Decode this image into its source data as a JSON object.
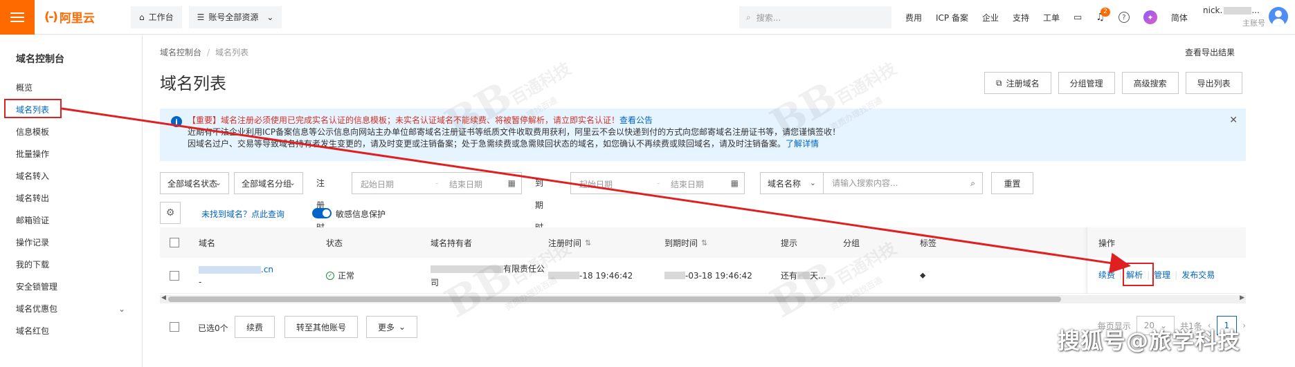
{
  "topbar": {
    "logo_mark": "(-)",
    "logo_text": "阿里云",
    "workbench": "工作台",
    "account_resources": "账号全部资源",
    "search_placeholder": "搜索...",
    "links": [
      "费用",
      "ICP 备案",
      "企业",
      "支持",
      "工单"
    ],
    "bell_badge": "2",
    "lang": "简体",
    "user_name": "nick.",
    "user_role": "主账号"
  },
  "sidebar": {
    "title": "域名控制台",
    "items": [
      {
        "label": "概览"
      },
      {
        "label": "域名列表",
        "active": true
      },
      {
        "label": "信息模板"
      },
      {
        "label": "批量操作"
      },
      {
        "label": "域名转入"
      },
      {
        "label": "域名转出"
      },
      {
        "label": "邮箱验证"
      },
      {
        "label": "操作记录"
      },
      {
        "label": "我的下载"
      },
      {
        "label": "安全锁管理"
      },
      {
        "label": "域名优惠包",
        "expandable": true
      },
      {
        "label": "域名红包"
      }
    ]
  },
  "main": {
    "breadcrumb": [
      "域名控制台",
      "域名列表"
    ],
    "export_result": "查看导出结果",
    "title": "域名列表",
    "header_buttons": {
      "register": "注册域名",
      "group": "分组管理",
      "advanced": "高级搜索",
      "export": "导出列表"
    },
    "notice": {
      "line1_red": "【重要】域名注册必须使用已完成实名认证的信息模板；未实名认证域名不能续费、将被暂停解析，请立即实名认证！",
      "line1_link": "查看公告",
      "line2": "近期有不法企业利用ICP备案信息等公示信息向网站主办单位邮寄域名注册证书等纸质文件收取费用获利，阿里云不会以快递到付的方式向您邮寄域名注册证书等，请您谨慎签收！",
      "line3": "因域名过户、交易等导致域名持有者发生变更的，请及时变更或注销备案；处于急需续费或急需赎回状态的域名，如您确认不再续费或赎回域名，请及时注销备案。",
      "line3_link": "了解详情"
    },
    "filters": {
      "status": "全部域名状态",
      "group": "全部域名分组",
      "reg_time_label": "注册时间",
      "exp_time_label": "到期时间",
      "start_date": "起始日期",
      "end_date": "结束日期",
      "date_sep": "-",
      "search_field": "域名名称",
      "search_placeholder": "请输入搜索内容...",
      "reset": "重置"
    },
    "row2": {
      "not_found_link": "未找到域名？点此查询",
      "sensitive_label": "敏感信息保护"
    },
    "table": {
      "columns": [
        "域名",
        "状态",
        "域名持有者",
        "注册时间",
        "到期时间",
        "提示",
        "分组",
        "标签",
        "操作"
      ],
      "rows": [
        {
          "domain": ".cn",
          "domain_sub": "-",
          "status": "正常",
          "owner_line1": "有限责任公",
          "owner_line2": "司",
          "reg_time": "-18 19:46:42",
          "exp_time": "-03-18 19:46:42",
          "tip": "还有",
          "tip_suffix": "天...",
          "ops": [
            "续费",
            "解析",
            "管理",
            "发布交易"
          ]
        }
      ]
    },
    "footer": {
      "selected": "已选0个",
      "renew": "续费",
      "transfer": "转至其他账号",
      "more": "更多",
      "per_page_label": "每页显示",
      "page_size": "20",
      "total": "共1条",
      "current_page": "1"
    }
  },
  "watermark": {
    "logo": "BB",
    "name": "百通科技",
    "sub": "资质办理找百通"
  },
  "brand_watermark": "搜狐号@旅学科技",
  "colors": {
    "brand": "#ff6a00",
    "link": "#0064c8",
    "highlight": "#e02020"
  }
}
